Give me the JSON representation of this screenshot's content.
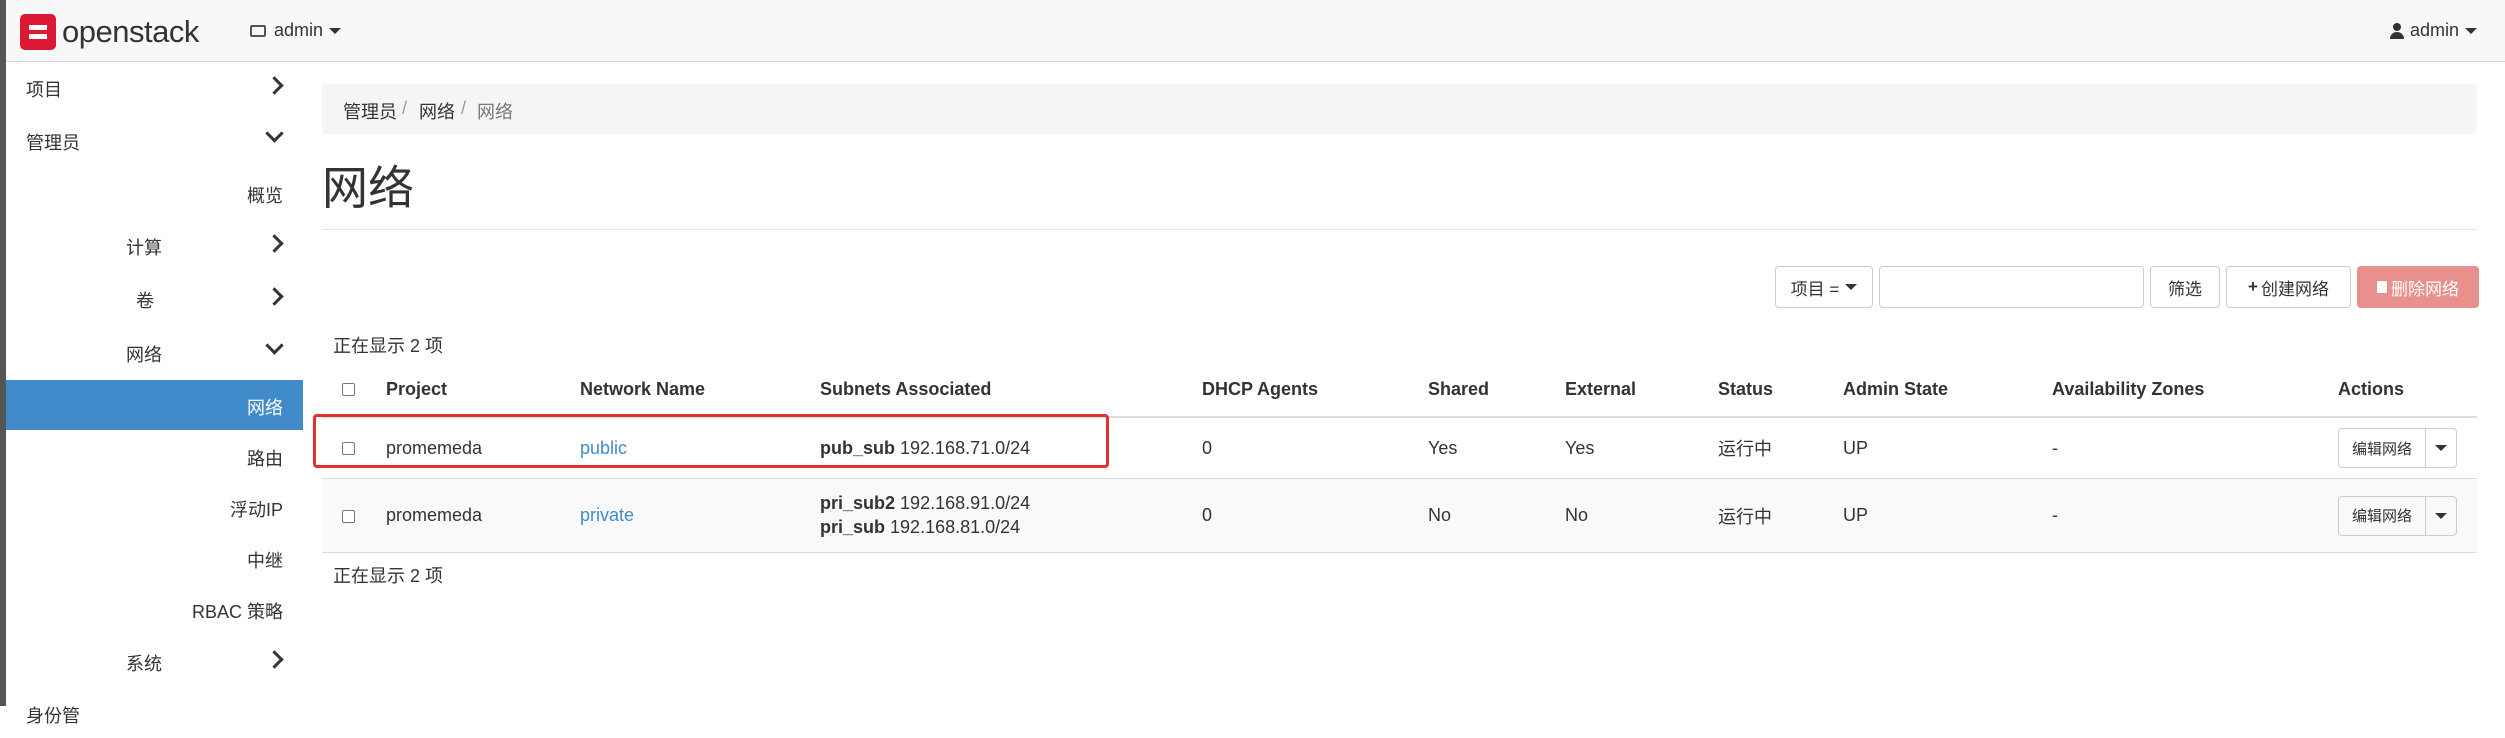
{
  "navbar": {
    "logo_text": "openstack",
    "project_label": "admin",
    "user_label": "admin"
  },
  "sidebar": {
    "items": [
      {
        "label": "项目",
        "chevron": "right"
      },
      {
        "label": "管理员",
        "chevron": "down"
      },
      {
        "label": "概览"
      },
      {
        "label": "计算",
        "chevron": "right"
      },
      {
        "label": "卷",
        "chevron": "right"
      },
      {
        "label": "网络",
        "chevron": "down"
      },
      {
        "label": "网络",
        "active": true
      },
      {
        "label": "路由"
      },
      {
        "label": "浮动IP"
      },
      {
        "label": "中继"
      },
      {
        "label": "RBAC 策略"
      },
      {
        "label": "系统",
        "chevron": "right"
      },
      {
        "label": "身份管"
      }
    ]
  },
  "breadcrumb": [
    "管理员",
    "网络",
    "网络"
  ],
  "page_title": "网络",
  "filter": {
    "dropdown_label": "项目 =",
    "input_value": "",
    "filter_button": "筛选",
    "create_button": "创建网络",
    "delete_button": "删除网络"
  },
  "showing_text_top": "正在显示 2 项",
  "showing_text_bottom": "正在显示 2 项",
  "table": {
    "headers": [
      "Project",
      "Network Name",
      "Subnets Associated",
      "DHCP Agents",
      "Shared",
      "External",
      "Status",
      "Admin State",
      "Availability Zones",
      "Actions"
    ],
    "rows": [
      {
        "project": "promemeda",
        "name": "public",
        "subnets": [
          {
            "name": "pub_sub",
            "cidr": "192.168.71.0/24"
          }
        ],
        "dhcp_agents": "0",
        "shared": "Yes",
        "external": "Yes",
        "status": "运行中",
        "admin_state": "UP",
        "zones": "-",
        "action": "编辑网络"
      },
      {
        "project": "promemeda",
        "name": "private",
        "subnets": [
          {
            "name": "pri_sub2",
            "cidr": "192.168.91.0/24"
          },
          {
            "name": "pri_sub",
            "cidr": "192.168.81.0/24"
          }
        ],
        "dhcp_agents": "0",
        "shared": "No",
        "external": "No",
        "status": "运行中",
        "admin_state": "UP",
        "zones": "-",
        "action": "编辑网络"
      }
    ]
  },
  "colors": {
    "brand_red": "#da1a32",
    "active_blue": "#428bca",
    "danger_light": "#e8908d",
    "highlight_red": "#e03030"
  }
}
